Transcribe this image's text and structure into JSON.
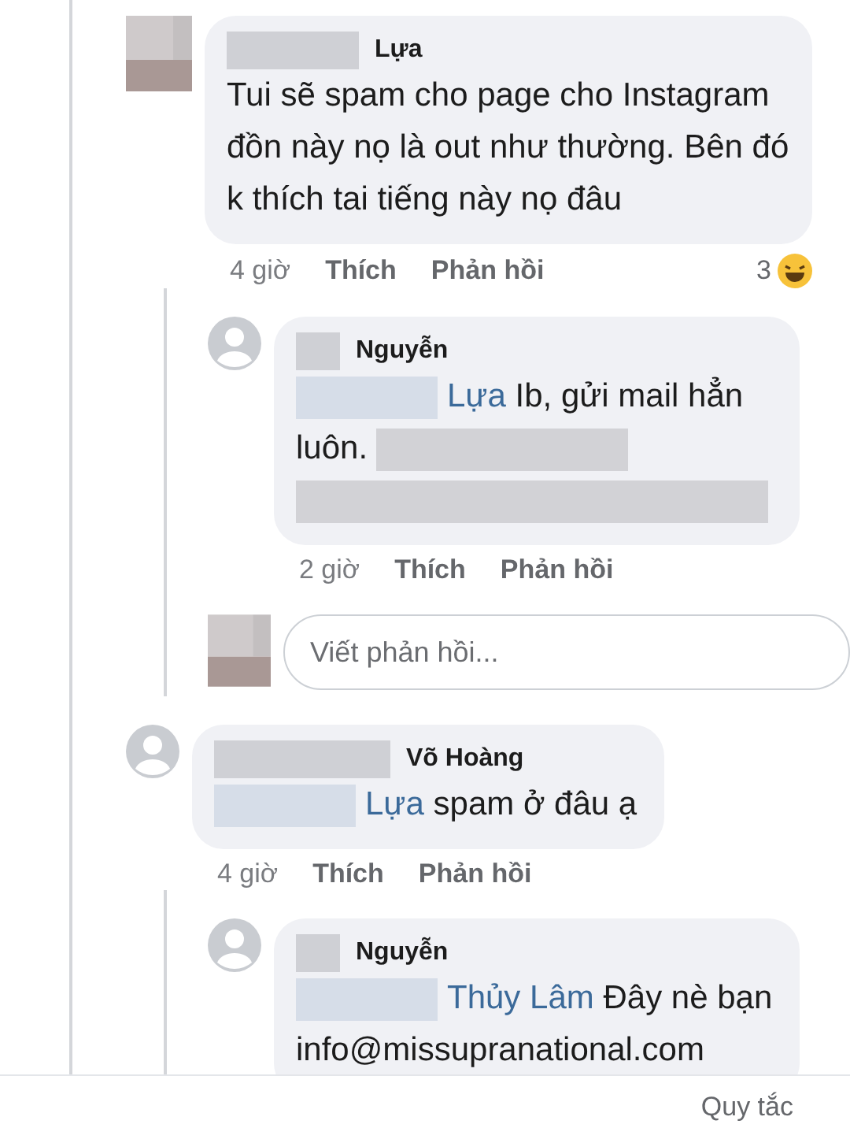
{
  "comments": [
    {
      "author": "Lựa",
      "kind": "pixelated_avatar",
      "text": "Tui sẽ spam cho page cho Instagram đồn này nọ là out như thường. Bên đó k thích tai tiếng này nọ đâu",
      "time": "4 giờ",
      "like": "Thích",
      "reply": "Phản hồi",
      "reaction_count": "3",
      "replies": [
        {
          "author": "Nguyễn",
          "kind": "default_avatar",
          "mention": "Lựa",
          "text": "Ib, gửi mail hẳn luôn.",
          "redacted_tail": true,
          "time": "2 giờ",
          "like": "Thích",
          "reply": "Phản hồi"
        }
      ],
      "reply_field": {
        "placeholder": "Viết phản hồi..."
      }
    },
    {
      "author": "Võ Hoàng",
      "kind": "default_avatar",
      "mention": "Lựa",
      "text": "spam ở đâu ạ",
      "time": "4 giờ",
      "like": "Thích",
      "reply": "Phản hồi",
      "replies": [
        {
          "author": "Nguyễn",
          "kind": "default_avatar",
          "mention": "Thủy Lâm",
          "text": "Đây nè bạn info@missupranational.com"
        }
      ]
    }
  ],
  "footer": {
    "link": "Quy tắc"
  }
}
